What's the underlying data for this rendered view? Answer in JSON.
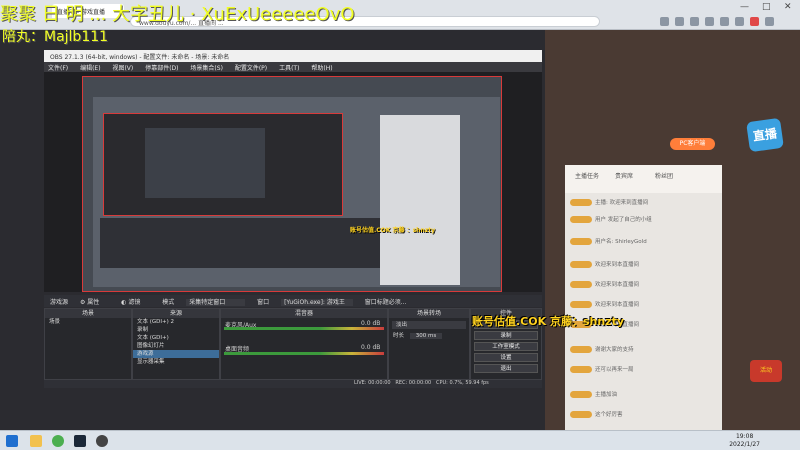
{
  "overlay": {
    "title": "聚聚 日 明 ... 大字丑儿 · XuExUeeeeeOvO",
    "sub": "陪丸：Majlb111",
    "account": "账号估值.COK 京藤：shnzty",
    "account_small": "账号估值.COK 京藤 ：shnzty"
  },
  "obs": {
    "window_title": "OBS 27.1.3 (64-bit, windows) - 配置文件: 未命名 - 场景: 未命名",
    "menu": [
      "文件(F)",
      "编辑(E)",
      "视图(V)",
      "停靠部件(D)",
      "场景集合(S)",
      "配置文件(P)",
      "工具(T)",
      "帮助(H)"
    ],
    "source_toolbar": {
      "source_name": "游戏源",
      "properties": "属性",
      "filters": "滤镜",
      "mode_label": "模式",
      "mode_value": "采集特定窗口",
      "window_label": "窗口",
      "window_value": "[YuGiOh.exe]: 游戏王",
      "priority_value": "窗口标题必须..."
    },
    "docks": {
      "scenes": {
        "header": "场景",
        "items": [
          "场景"
        ]
      },
      "sources": {
        "header": "来源",
        "items": [
          "文本 (GDI+) 2",
          "录制",
          "文本 (GDI+)",
          "图像幻灯片",
          "游戏源",
          "显示器采集"
        ]
      },
      "mixer": {
        "header": "混音器",
        "items": [
          {
            "name": "麦克风/Aux",
            "level": "0.0 dB"
          },
          {
            "name": "桌面音频",
            "level": "0.0 dB"
          }
        ]
      },
      "transitions": {
        "header": "场景转场",
        "type": "淡出",
        "duration_label": "时长",
        "duration_value": "300 ms"
      },
      "controls": {
        "header": "控件",
        "buttons": [
          "停止推流",
          "录制",
          "工作室模式",
          "设置",
          "退出"
        ]
      }
    },
    "status": {
      "live": "LIVE: 00:00:00",
      "rec": "REC: 00:00:00",
      "cpu": "CPU: 0.7%, 59.94 fps"
    }
  },
  "stream_page": {
    "pc_button": "PC客户端",
    "logo": "直播",
    "chat_tabs": [
      "主播任务",
      "贵宾席",
      "粉丝团"
    ],
    "chat_lines": [
      "主播: 欢迎来到直播间",
      "用户 发起了自己的小组",
      "用户名: ShirleyGold",
      "欢迎来到本直播间",
      "欢迎来到本直播间",
      "欢迎来到本直播间",
      "欢迎来到本直播间",
      "谢谢大家的支持",
      "还可以再来一局",
      "主播加油",
      "这个好厉害"
    ],
    "activity_button": "活动"
  },
  "browser": {
    "tab": "直播间 - 游戏直播",
    "address": "www.douyu.com/... 直播间 ..."
  },
  "taskbar": {
    "time": "19:08",
    "date": "2022/1/27"
  }
}
